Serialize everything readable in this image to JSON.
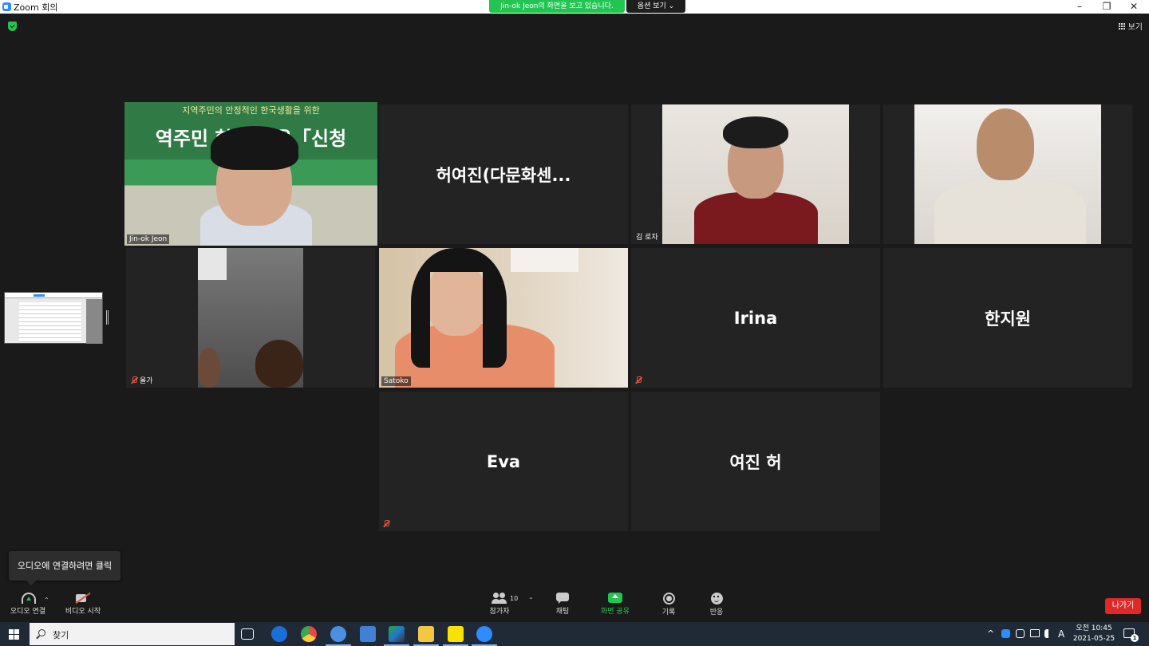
{
  "window": {
    "title": "Zoom 회의"
  },
  "share_banner": {
    "text": "Jin-ok  Jeon의 화면을 보고 있습니다.",
    "options_label": "옵션 보기 ⌄"
  },
  "view_button": {
    "label": "보기"
  },
  "host_video": {
    "banner_top": "지역주민의 안정적인 한국생활을 위한",
    "banner_main": "역주민 한국 교육「신청"
  },
  "participants": [
    {
      "name": "Jin-ok Jeon",
      "video": true,
      "active_speaker": true,
      "muted": false
    },
    {
      "name": "허여진(다문화센...",
      "video": false,
      "muted": false
    },
    {
      "name": "김 로자",
      "video": true,
      "muted": false
    },
    {
      "name": "",
      "video": true,
      "muted": false
    },
    {
      "name": "올가",
      "video": true,
      "muted": true
    },
    {
      "name": "Satoko",
      "video": true,
      "muted": false
    },
    {
      "name": "Irina",
      "video": false,
      "muted": true
    },
    {
      "name": "한지원",
      "video": false,
      "muted": false
    },
    {
      "name": "Eva",
      "video": false,
      "muted": true
    },
    {
      "name": "여진 허",
      "video": false,
      "muted": false
    }
  ],
  "tooltip": {
    "text": "오디오에 연결하려면 클릭"
  },
  "toolbar": {
    "audio_label": "오디오 연결",
    "video_label": "비디오 시작",
    "participants_label": "참가자",
    "participants_count": "10",
    "chat_label": "채팅",
    "share_label": "화면 공유",
    "record_label": "기록",
    "reactions_label": "반응",
    "leave_label": "나가기",
    "caret": "⌃"
  },
  "taskbar": {
    "search_placeholder": "찾기",
    "clock_time": "오전 10:45",
    "clock_date": "2021-05-25",
    "notification_count": "1",
    "ime_label": "A",
    "tray_chevron": "^"
  },
  "colors": {
    "zoom_blue": "#2d8cff",
    "share_green": "#23c552",
    "leave_red": "#e02828",
    "active_outline": "#e9e52a",
    "mute_red": "#e0533a"
  }
}
